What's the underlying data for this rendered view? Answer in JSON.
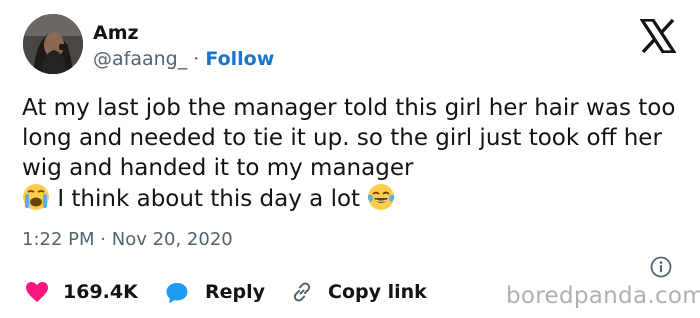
{
  "author": {
    "display_name": "Amz",
    "handle": "@afaang_",
    "separator": "·",
    "follow_label": "Follow"
  },
  "tweet": {
    "text_main": "At my last job the manager told this girl her hair was too long and needed to tie it up. so the girl just took off her wig and handed it to my manager",
    "text_tail": "I think about this day a lot",
    "emoji_1": "loudly-crying-face",
    "emoji_2": "face-with-tears-of-joy"
  },
  "meta": {
    "time": "1:22 PM",
    "separator": "·",
    "date": "Nov 20, 2020"
  },
  "actions": {
    "likes": "169.4K",
    "reply_label": "Reply",
    "copy_link_label": "Copy link"
  },
  "icons": {
    "brand": "x-logo-icon",
    "info": "info-icon",
    "like": "heart-icon",
    "reply": "reply-bubble-icon",
    "link": "link-icon"
  },
  "colors": {
    "follow": "#1d74c8",
    "like": "#f91880",
    "reply": "#1d9bf0",
    "secondary_text": "#536471",
    "watermark": "#b0b0b0"
  },
  "watermark": "boredpanda.com"
}
